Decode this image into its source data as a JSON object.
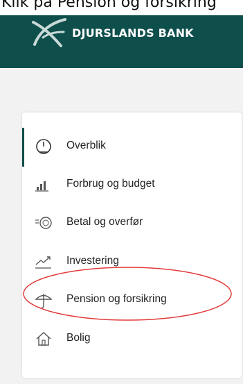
{
  "caption": "Klik på Pension og forsikring",
  "header": {
    "bank_name": "DJURSLANDS BANK"
  },
  "nav": {
    "items": [
      {
        "label": "Overblik",
        "icon": "gauge-icon"
      },
      {
        "label": "Forbrug og budget",
        "icon": "bar-chart-icon"
      },
      {
        "label": "Betal og overfør",
        "icon": "payment-icon"
      },
      {
        "label": "Investering",
        "icon": "trend-line-icon"
      },
      {
        "label": "Pension og forsikring",
        "icon": "umbrella-icon"
      },
      {
        "label": "Bolig",
        "icon": "house-icon"
      }
    ],
    "active_index": 0,
    "highlighted_index": 4
  },
  "colors": {
    "brand": "#0e4f4c",
    "highlight": "#e23b3b",
    "background": "#f2f2f2"
  }
}
